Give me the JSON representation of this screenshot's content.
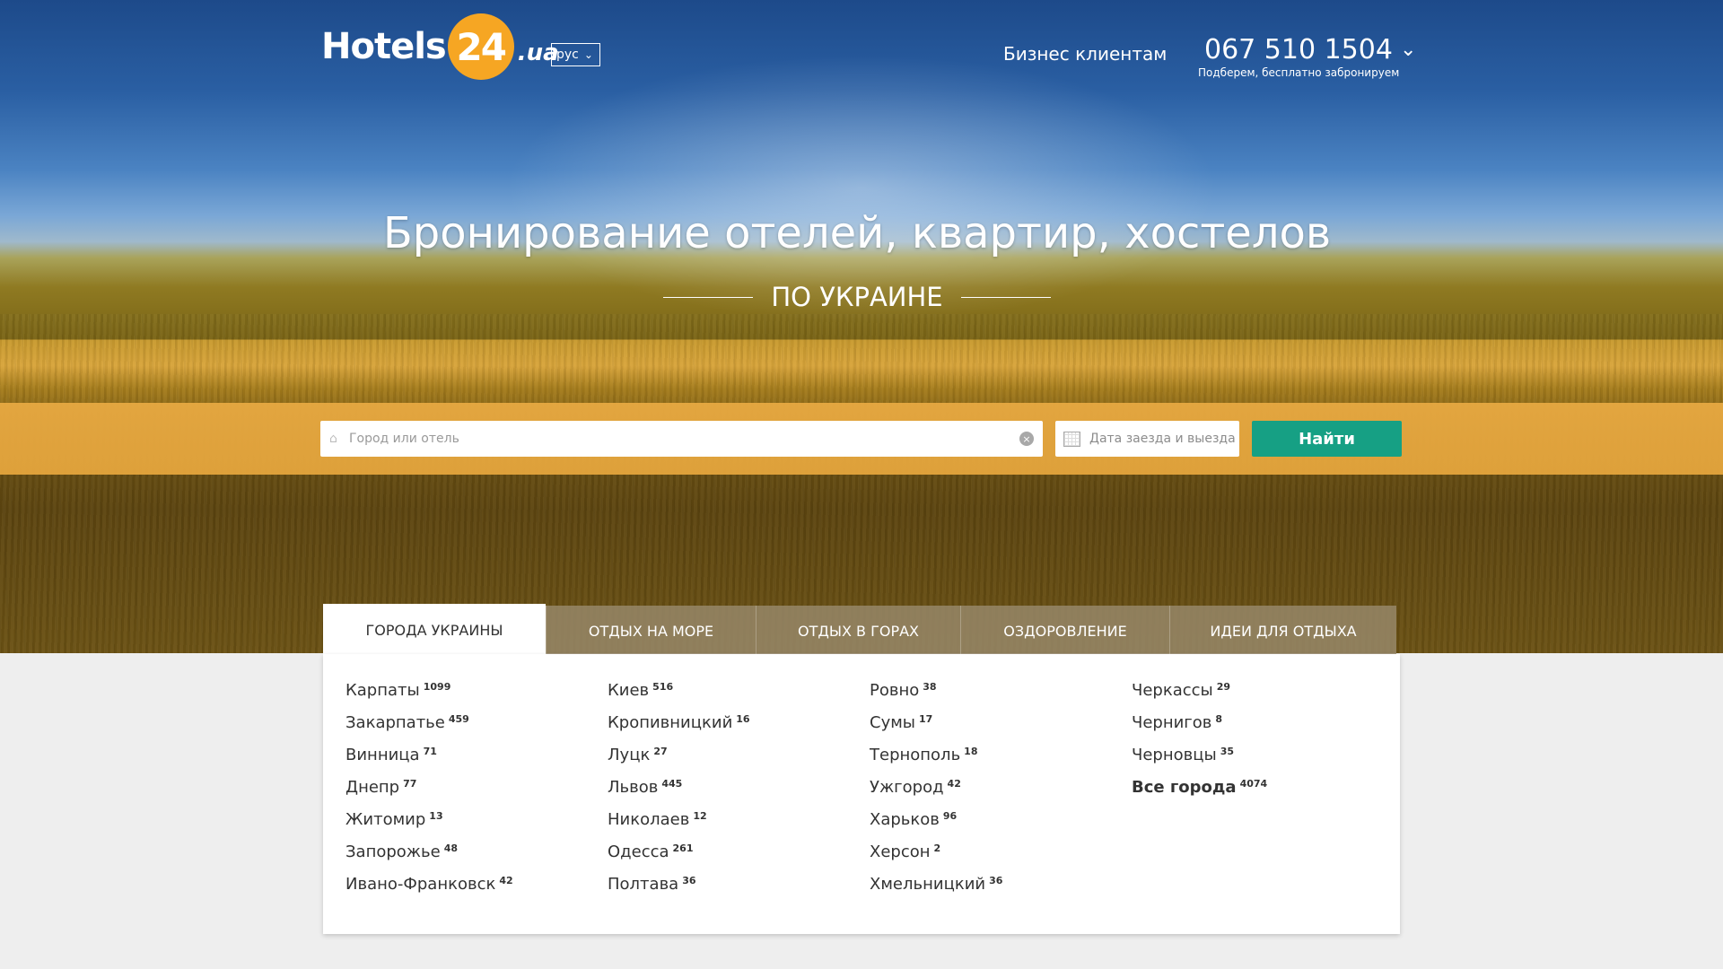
{
  "header": {
    "logo": {
      "text": "Hotels",
      "num": "24",
      "domain": ".ua"
    },
    "language": "рус",
    "business_link": "Бизнес клиентам",
    "phone": "067 510 1504",
    "phone_sub": "Подберем, бесплатно забронируем"
  },
  "hero": {
    "title": "Бронирование отелей, квартир, хостелов",
    "subtitle": "ПО УКРАИНЕ"
  },
  "search": {
    "city_placeholder": "Город или отель",
    "date_placeholder": "Дата заезда и выезда",
    "submit_label": "Найти"
  },
  "tabs": [
    {
      "label": "ГОРОДА УКРАИНЫ",
      "active": true
    },
    {
      "label": "ОТДЫХ НА МОРЕ",
      "active": false
    },
    {
      "label": "ОТДЫХ В ГОРАХ",
      "active": false
    },
    {
      "label": "ОЗДОРОВЛЕНИЕ",
      "active": false
    },
    {
      "label": "ИДЕИ ДЛЯ ОТДЫХА",
      "active": false
    }
  ],
  "cities": {
    "col1": [
      {
        "name": "Карпаты",
        "count": "1099"
      },
      {
        "name": "Закарпатье",
        "count": "459"
      },
      {
        "name": "Винница",
        "count": "71"
      },
      {
        "name": "Днепр",
        "count": "77"
      },
      {
        "name": "Житомир",
        "count": "13"
      },
      {
        "name": "Запорожье",
        "count": "48"
      },
      {
        "name": "Ивано-Франковск",
        "count": "42"
      }
    ],
    "col2": [
      {
        "name": "Киев",
        "count": "516"
      },
      {
        "name": "Кропивницкий",
        "count": "16"
      },
      {
        "name": "Луцк",
        "count": "27"
      },
      {
        "name": "Львов",
        "count": "445"
      },
      {
        "name": "Николаев",
        "count": "12"
      },
      {
        "name": "Одесса",
        "count": "261"
      },
      {
        "name": "Полтава",
        "count": "36"
      }
    ],
    "col3": [
      {
        "name": "Ровно",
        "count": "38"
      },
      {
        "name": "Сумы",
        "count": "17"
      },
      {
        "name": "Тернополь",
        "count": "18"
      },
      {
        "name": "Ужгород",
        "count": "42"
      },
      {
        "name": "Харьков",
        "count": "96"
      },
      {
        "name": "Херсон",
        "count": "2"
      },
      {
        "name": "Хмельницкий",
        "count": "36"
      }
    ],
    "col4": [
      {
        "name": "Черкассы",
        "count": "29"
      },
      {
        "name": "Чернигов",
        "count": "8"
      },
      {
        "name": "Черновцы",
        "count": "35"
      },
      {
        "name": "Все города",
        "count": "4074"
      }
    ]
  },
  "colors": {
    "accent_green": "#16a084",
    "stripe_yellow": "#e3a43c",
    "logo_orange": "#f6a623"
  },
  "icons": [
    "home-icon",
    "clear-icon",
    "calendar-icon",
    "chevron-down-icon"
  ]
}
